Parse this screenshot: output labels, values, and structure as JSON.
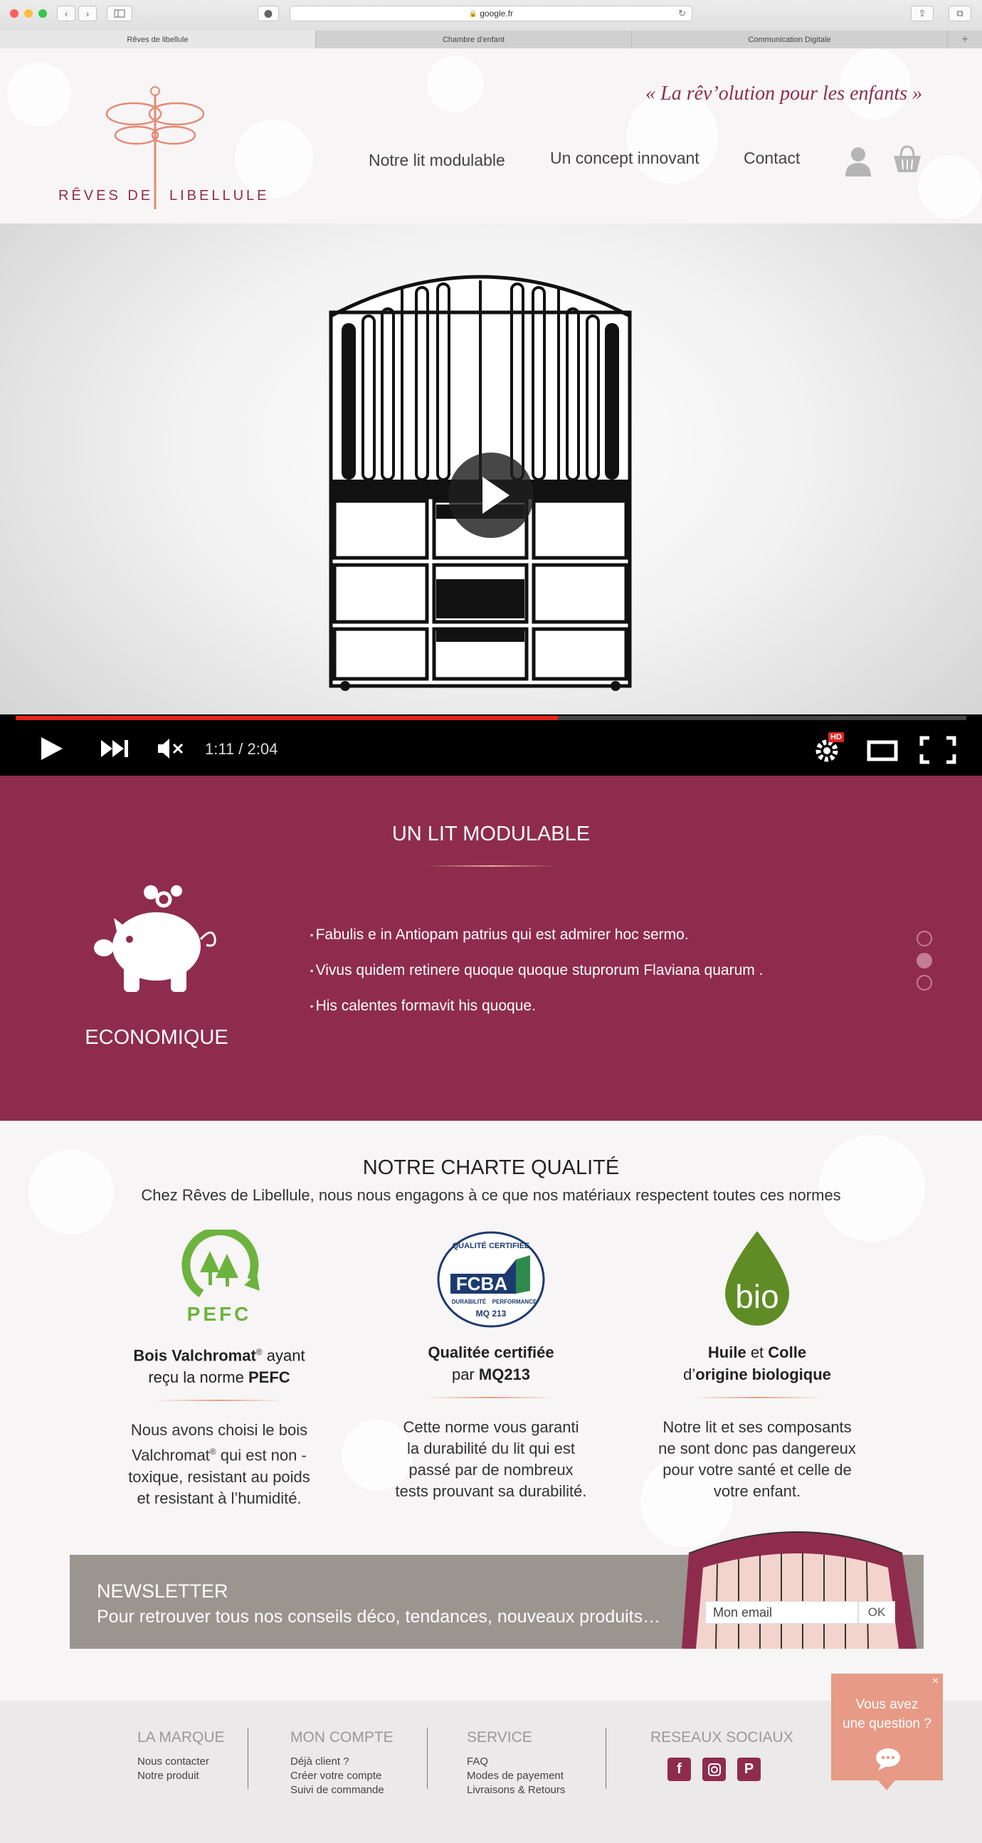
{
  "browser": {
    "url": "google.fr",
    "tabs": [
      "Rêves de libellule",
      "Chambre d'enfant",
      "Communication Digitale"
    ],
    "add_tab": "+"
  },
  "header": {
    "logo_left": "RÊVES DE",
    "logo_right": "LIBELLULE",
    "tagline": "« La rêv’olution pour les enfants »",
    "nav": {
      "lit": "Notre lit modulable",
      "concept": "Un concept innovant",
      "contact": "Contact"
    },
    "icons": [
      "user-icon",
      "basket-icon"
    ]
  },
  "video": {
    "time": "1:11 / 2:04",
    "progress": 0.57,
    "hd_badge": "HD",
    "controls": [
      "play-icon",
      "next-icon",
      "mute-icon",
      "settings-icon",
      "theater-icon",
      "fullscreen-icon"
    ]
  },
  "modulable": {
    "title": "UN LIT MODULABLE",
    "feature_label": "ECONOMIQUE",
    "bullets": [
      "Fabulis e in Antiopam patrius qui est admirer hoc sermo.",
      "Vivus quidem retinere quoque quoque stuprorum Flaviana quarum .",
      "His calentes formavit his quoque."
    ],
    "active_dot": 1,
    "accent": "#8f2c4d"
  },
  "charter": {
    "title": "NOTRE CHARTE QUALITÉ",
    "subtitle": "Chez Rêves de Libellule, nous nous engagons à ce que nos matériaux respectent toutes ces normes",
    "items": [
      {
        "logo_text": "PEFC",
        "head_bold1": "Bois Valchromat",
        "head_sup": "®",
        "head_rest1": " ayant",
        "head_line2_a": "reçu la norme ",
        "head_line2_b": "PEFC",
        "text1": "Nous avons choisi le bois",
        "text2a": "Valchromat",
        "text2sup": "®",
        "text2b": " qui est non -",
        "text3": "toxique, resistant au poids",
        "text4": "et resistant à l’humidité."
      },
      {
        "logo_top": "QUALITÉ CERTIFIÉE",
        "logo_text": "FCBA",
        "logo_sub1": "DURABILITÉ",
        "logo_sub2": "PERFORMANCE",
        "logo_code": "MQ 213",
        "head_line1": "Qualitée certifiée",
        "head_line2_a": "par ",
        "head_line2_b": "MQ213",
        "text1": "Cette norme vous garanti",
        "text2": "la durabilité du lit qui est",
        "text3": "passé par de nombreux",
        "text4": "tests prouvant sa durabilité."
      },
      {
        "logo_text": "bio",
        "head_a": "Huile",
        "head_b": " et ",
        "head_c": "Colle",
        "head_line2_a": "d’",
        "head_line2_b": "origine biologique",
        "text1": "Notre lit et ses composants",
        "text2": "ne sont donc pas dangereux",
        "text3": "pour votre santé et celle de",
        "text4": "votre enfant."
      }
    ]
  },
  "newsletter": {
    "title": "NEWSLETTER",
    "text": "Pour retrouver tous nos conseils déco, tendances, nouveaux produits…",
    "input_value": "Mon email",
    "ok": "OK"
  },
  "footer": {
    "marque": {
      "title": "LA MARQUE",
      "links": [
        "Nous contacter",
        "Notre produit"
      ]
    },
    "compte": {
      "title": "MON COMPTE",
      "links": [
        "Déjà client ?",
        "Créer votre compte",
        "Suivi de commande"
      ]
    },
    "service": {
      "title": "SERVICE",
      "links": [
        "FAQ",
        "Modes de payement",
        "Livraisons & Retours"
      ]
    },
    "social": {
      "title": "RESEAUX SOCIAUX",
      "icons": [
        "facebook-icon",
        "instagram-icon",
        "pinterest-icon"
      ],
      "f": "f",
      "p": "P"
    }
  },
  "chat": {
    "line1": "Vous avez",
    "line2": "une question ?",
    "close": "×"
  }
}
